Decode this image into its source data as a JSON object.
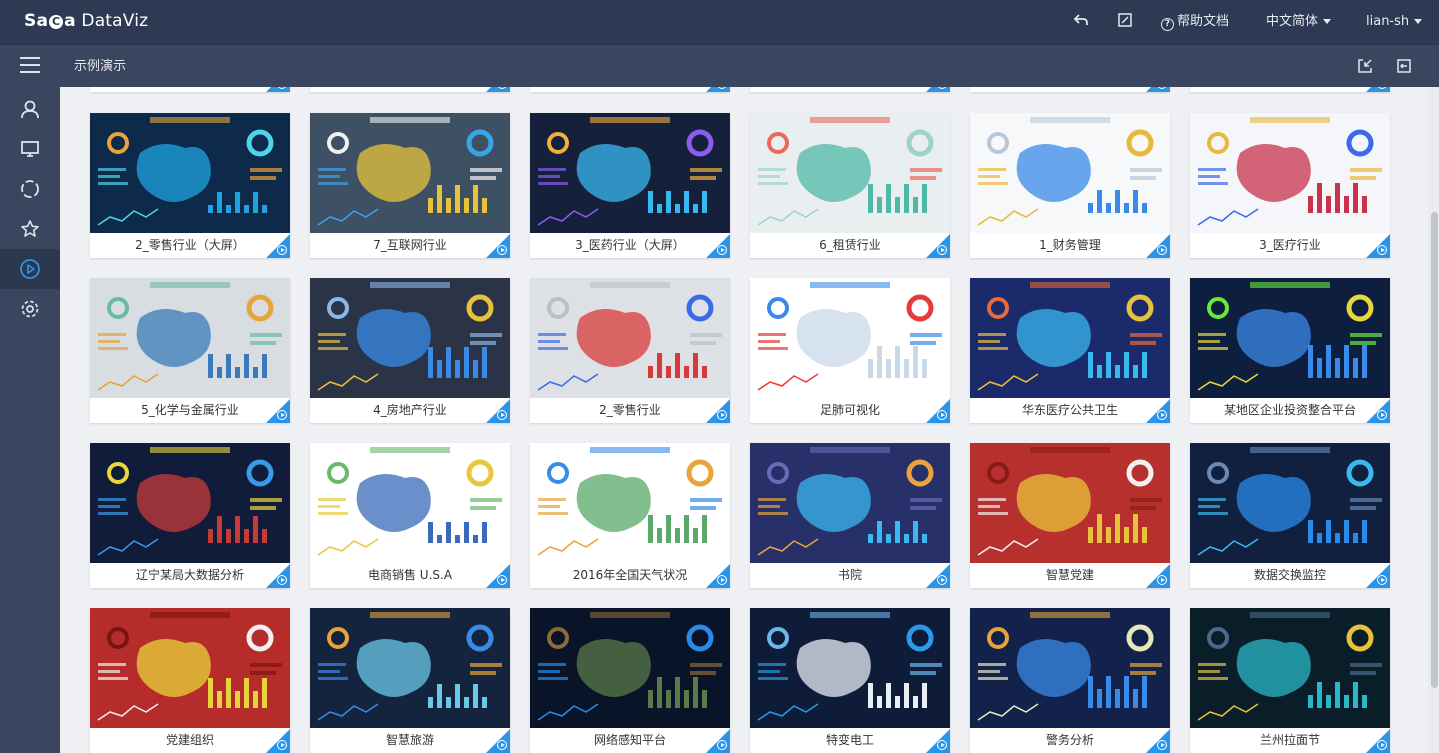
{
  "app": {
    "logo_bold": "Sa",
    "logo_mid": "C",
    "logo_a": "a",
    "logo_thin": " DataViz"
  },
  "topbar": {
    "help_label": "帮助文档",
    "language_label": "中文简体",
    "user_label": "lian-sh"
  },
  "subbar": {
    "breadcrumb": "示例演示"
  },
  "colors": {
    "topbar_bg": "#2e3a53",
    "subbar_bg": "#3a4660",
    "accent": "#2a95e8",
    "active_sidebar_icon": "#2a95e8"
  },
  "sidebar": {
    "items": [
      {
        "icon": "user-icon"
      },
      {
        "icon": "monitor-icon"
      },
      {
        "icon": "loading-circle-icon"
      },
      {
        "icon": "star-icon"
      },
      {
        "icon": "play-circle-icon",
        "active": true
      },
      {
        "icon": "gear-icon"
      }
    ]
  },
  "gallery": {
    "rows": [
      [
        {
          "title": "2_零售行业（大屏）",
          "theme": "dark-map"
        },
        {
          "title": "7_互联网行业",
          "theme": "slate"
        },
        {
          "title": "3_医药行业（大屏）",
          "theme": "dark-bars"
        },
        {
          "title": "6_租赁行业",
          "theme": "light-teal"
        },
        {
          "title": "1_财务管理",
          "theme": "white-blue"
        },
        {
          "title": "3_医疗行业",
          "theme": "white-red"
        }
      ],
      [
        {
          "title": "5_化学与金属行业",
          "theme": "light-gray"
        },
        {
          "title": "4_房地产行业",
          "theme": "dark-slate"
        },
        {
          "title": "2_零售行业",
          "theme": "light-red"
        },
        {
          "title": "足肺可视化",
          "theme": "white-map"
        },
        {
          "title": "华东医疗公共卫生",
          "theme": "navy-grid"
        },
        {
          "title": "某地区企业投资整合平台",
          "theme": "navy-map"
        }
      ],
      [
        {
          "title": "辽宁某局大数据分析",
          "theme": "navy-red"
        },
        {
          "title": "电商销售 U.S.A",
          "theme": "white-radar"
        },
        {
          "title": "2016年全国天气状况",
          "theme": "white-china"
        },
        {
          "title": "书院",
          "theme": "purple-grid"
        },
        {
          "title": "智慧党建",
          "theme": "red"
        },
        {
          "title": "数据交换监控",
          "theme": "navy-bars"
        }
      ],
      [
        {
          "title": "党建组织",
          "theme": "red2"
        },
        {
          "title": "智慧旅游",
          "theme": "navy-map2"
        },
        {
          "title": "网络感知平台",
          "theme": "satellite"
        },
        {
          "title": "特变电工",
          "theme": "navy-white-map"
        },
        {
          "title": "警务分析",
          "theme": "navy-map3"
        },
        {
          "title": "兰州拉面节",
          "theme": "dark-teal-map"
        }
      ]
    ]
  }
}
